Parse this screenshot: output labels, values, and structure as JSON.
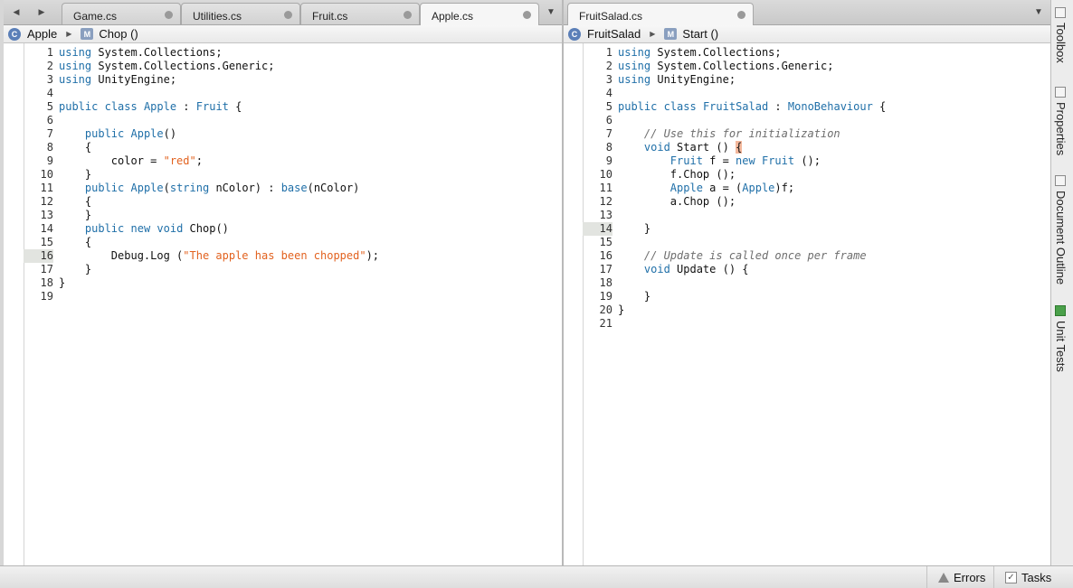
{
  "left_pane": {
    "tabs": [
      {
        "label": "Game.cs"
      },
      {
        "label": "Utilities.cs"
      },
      {
        "label": "Fruit.cs"
      },
      {
        "label": "Apple.cs"
      }
    ],
    "breadcrumb": {
      "class_name": "Apple",
      "method_name": "Chop ()"
    },
    "current_line": "16",
    "lines": [
      {
        "n": "1",
        "t": "using System.Collections;"
      },
      {
        "n": "2",
        "t": "using System.Collections.Generic;"
      },
      {
        "n": "3",
        "t": "using UnityEngine;"
      },
      {
        "n": "4",
        "t": ""
      },
      {
        "n": "5",
        "t": "public class Apple : Fruit {"
      },
      {
        "n": "6",
        "t": ""
      },
      {
        "n": "7",
        "t": "    public Apple()"
      },
      {
        "n": "8",
        "t": "    {"
      },
      {
        "n": "9",
        "t": "        color = \"red\";"
      },
      {
        "n": "10",
        "t": "    }"
      },
      {
        "n": "11",
        "t": "    public Apple(string nColor) : base(nColor)"
      },
      {
        "n": "12",
        "t": "    {"
      },
      {
        "n": "13",
        "t": "    }"
      },
      {
        "n": "14",
        "t": "    public new void Chop()"
      },
      {
        "n": "15",
        "t": "    {"
      },
      {
        "n": "16",
        "t": "        Debug.Log (\"The apple has been chopped\");"
      },
      {
        "n": "17",
        "t": "    }"
      },
      {
        "n": "18",
        "t": "}"
      },
      {
        "n": "19",
        "t": ""
      }
    ]
  },
  "right_pane": {
    "tabs": [
      {
        "label": "FruitSalad.cs"
      }
    ],
    "breadcrumb": {
      "class_name": "FruitSalad",
      "method_name": "Start ()"
    },
    "current_line": "14",
    "lines": [
      {
        "n": "1",
        "t": "using System.Collections;"
      },
      {
        "n": "2",
        "t": "using System.Collections.Generic;"
      },
      {
        "n": "3",
        "t": "using UnityEngine;"
      },
      {
        "n": "4",
        "t": ""
      },
      {
        "n": "5",
        "t": "public class FruitSalad : MonoBehaviour {"
      },
      {
        "n": "6",
        "t": ""
      },
      {
        "n": "7",
        "t": "    // Use this for initialization"
      },
      {
        "n": "8",
        "t": "    void Start () {"
      },
      {
        "n": "9",
        "t": "        Fruit f = new Fruit ();"
      },
      {
        "n": "10",
        "t": "        f.Chop ();"
      },
      {
        "n": "11",
        "t": "        Apple a = (Apple)f;"
      },
      {
        "n": "12",
        "t": "        a.Chop ();"
      },
      {
        "n": "13",
        "t": ""
      },
      {
        "n": "14",
        "t": "    }"
      },
      {
        "n": "15",
        "t": ""
      },
      {
        "n": "16",
        "t": "    // Update is called once per frame"
      },
      {
        "n": "17",
        "t": "    void Update () {"
      },
      {
        "n": "18",
        "t": ""
      },
      {
        "n": "19",
        "t": "    }"
      },
      {
        "n": "20",
        "t": "}"
      },
      {
        "n": "21",
        "t": ""
      }
    ]
  },
  "side_pads": [
    {
      "label": "Toolbox",
      "icon": "toolbox-icon"
    },
    {
      "label": "Properties",
      "icon": "properties-icon"
    },
    {
      "label": "Document Outline",
      "icon": "document-outline-icon"
    },
    {
      "label": "Unit Tests",
      "icon": "unit-tests-icon"
    }
  ],
  "status": {
    "errors_label": "Errors",
    "tasks_label": "Tasks"
  },
  "icons": {
    "nav_back": "◀",
    "nav_forward": "▶",
    "tab_list": "▼",
    "class_badge": "C",
    "method_badge": "M",
    "breadcrumb_separator": "▶"
  },
  "colors": {
    "keyword": "#1f6fa8",
    "string": "#e2621f",
    "comment": "#6e6e6e",
    "brace_highlight": "#f4b89c"
  }
}
